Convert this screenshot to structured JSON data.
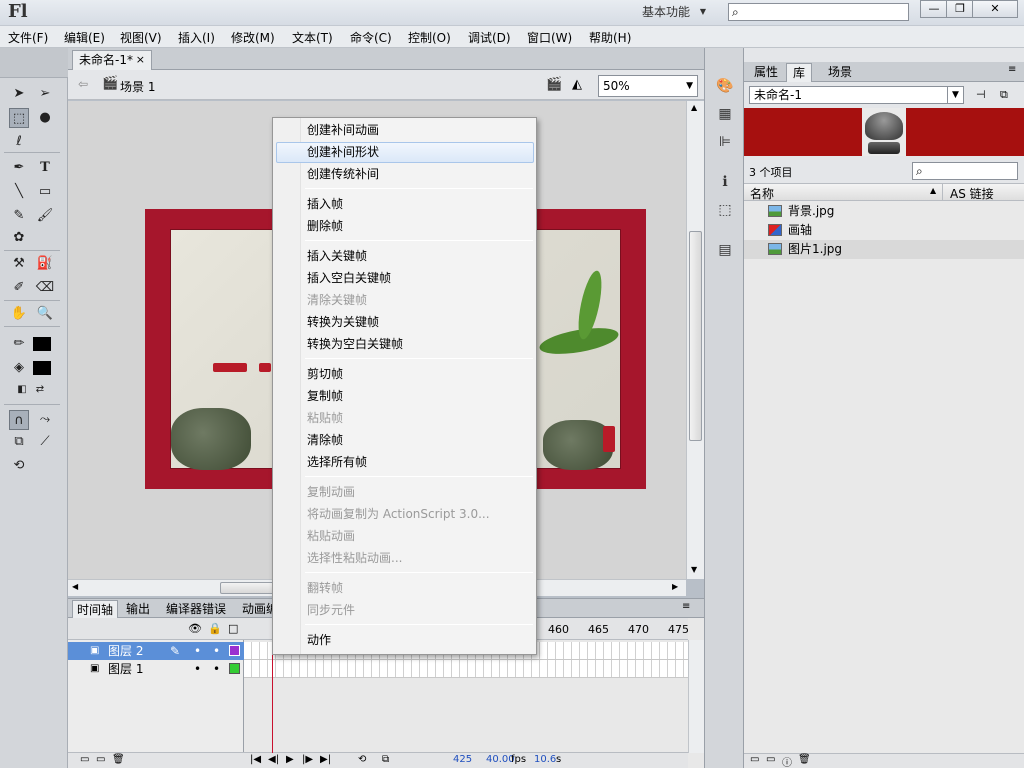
{
  "app": {
    "logo": "Fl",
    "workspace": "基本功能",
    "window_buttons": {
      "minimize": "—",
      "maximize": "❐",
      "close": "✕"
    }
  },
  "menubar": [
    "文件(F)",
    "编辑(E)",
    "视图(V)",
    "插入(I)",
    "修改(M)",
    "文本(T)",
    "命令(C)",
    "控制(O)",
    "调试(D)",
    "窗口(W)",
    "帮助(H)"
  ],
  "document": {
    "tab_title": "未命名-1*",
    "tab_close": "×",
    "scene": "场景 1",
    "zoom": "50%"
  },
  "context_menu": {
    "items": [
      {
        "label": "创建补间动画",
        "enabled": true
      },
      {
        "label": "创建补间形状",
        "enabled": true,
        "highlighted": true
      },
      {
        "label": "创建传统补间",
        "enabled": true
      },
      {
        "label": "插入帧",
        "enabled": true
      },
      {
        "label": "删除帧",
        "enabled": true
      },
      {
        "label": "插入关键帧",
        "enabled": true
      },
      {
        "label": "插入空白关键帧",
        "enabled": true
      },
      {
        "label": "清除关键帧",
        "enabled": false
      },
      {
        "label": "转换为关键帧",
        "enabled": true
      },
      {
        "label": "转换为空白关键帧",
        "enabled": true
      },
      {
        "label": "剪切帧",
        "enabled": true
      },
      {
        "label": "复制帧",
        "enabled": true
      },
      {
        "label": "粘贴帧",
        "enabled": false
      },
      {
        "label": "清除帧",
        "enabled": true
      },
      {
        "label": "选择所有帧",
        "enabled": true
      },
      {
        "label": "复制动画",
        "enabled": false
      },
      {
        "label": "将动画复制为 ActionScript 3.0...",
        "enabled": false
      },
      {
        "label": "粘贴动画",
        "enabled": false
      },
      {
        "label": "选择性粘贴动画...",
        "enabled": false
      },
      {
        "label": "翻转帧",
        "enabled": false
      },
      {
        "label": "同步元件",
        "enabled": false
      },
      {
        "label": "动作",
        "enabled": true
      }
    ]
  },
  "timeline": {
    "tabs": [
      "时间轴",
      "输出",
      "编译器错误",
      "动画编"
    ],
    "frame_numbers": [
      "460",
      "465",
      "470",
      "475"
    ],
    "layers": [
      {
        "name": "图层 2",
        "selected": true,
        "color": "#9b30d0"
      },
      {
        "name": "图层 1",
        "selected": false,
        "color": "#33cc33"
      }
    ],
    "status": {
      "frame": "425",
      "fps": "40.00",
      "fps_unit": "fps",
      "time": "10.6",
      "time_unit": "s"
    }
  },
  "library": {
    "tabs": [
      "属性",
      "库",
      "场景"
    ],
    "active_tab": "库",
    "document": "未命名-1",
    "count": "3 个项目",
    "columns": {
      "name": "名称",
      "linkage": "AS 链接"
    },
    "items": [
      {
        "name": "背景.jpg",
        "type": "bitmap"
      },
      {
        "name": "画轴",
        "type": "symbol"
      },
      {
        "name": "图片1.jpg",
        "type": "bitmap",
        "selected": true
      }
    ]
  },
  "colors": {
    "frame_red": "#a6162c",
    "selection_blue": "#5b8fd8",
    "playhead": "#c8102e"
  }
}
